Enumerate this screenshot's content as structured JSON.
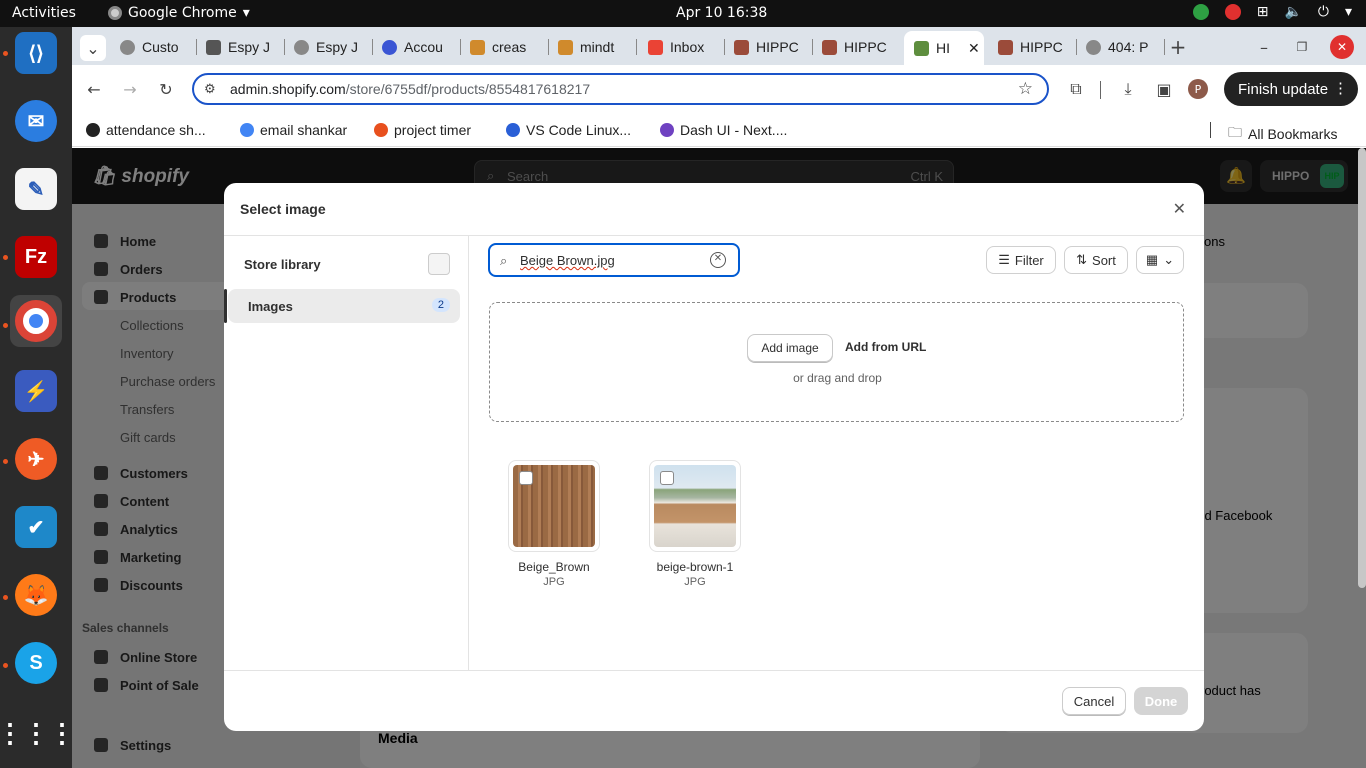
{
  "system": {
    "activities": "Activities",
    "app_name": "Google Chrome",
    "clock": "Apr 10  16:38"
  },
  "dock": {
    "items": [
      "vscode-icon",
      "thunderbird-icon",
      "text-editor-icon",
      "filezilla-icon",
      "chrome-icon",
      "network-icon",
      "postman-icon",
      "todo-icon",
      "firefox-icon",
      "skype-icon",
      "app-grid-icon"
    ]
  },
  "browser": {
    "tabs": [
      "Custo",
      "Espy J",
      "Espy J",
      "Accou",
      "creas",
      "mindt",
      "Inbox",
      "HIPPC",
      "HIPPC",
      "HI",
      "HIPPC",
      "404: P"
    ],
    "active_tab_index": 9,
    "url_host": "admin.shopify.com",
    "url_path": "/store/6755df/products/8554817618217",
    "finish_update": "Finish update",
    "profile_initial": "P",
    "bookmarks": [
      "attendance sh...",
      "email shankar",
      "project timer",
      "VS Code Linux...",
      "Dash UI - Next...."
    ],
    "all_bookmarks": "All Bookmarks"
  },
  "shopify": {
    "logo": "shopify",
    "search_placeholder": "Search",
    "search_shortcut": "Ctrl K",
    "store_name": "HIPPO",
    "store_badge": "HIP",
    "nav": {
      "home": "Home",
      "orders": "Orders",
      "products": "Products",
      "collections": "Collections",
      "inventory": "Inventory",
      "purchase_orders": "Purchase orders",
      "transfers": "Transfers",
      "gift_cards": "Gift cards",
      "customers": "Customers",
      "content": "Content",
      "analytics": "Analytics",
      "marketing": "Marketing",
      "discounts": "Discounts",
      "sales_channels": "Sales channels",
      "online_store": "Online Store",
      "point_of_sale": "Point of Sale",
      "settings": "Settings"
    },
    "background": {
      "media_heading": "Media",
      "partial_ons": "ons",
      "and_facebook": "and Facebook",
      "product_has": "roduct has"
    }
  },
  "modal": {
    "title": "Select image",
    "store_library": "Store library",
    "images_label": "Images",
    "images_count": "2",
    "search_value": "Beige Brown.jpg",
    "filter": "Filter",
    "sort": "Sort",
    "add_image": "Add image",
    "add_from_url": "Add from URL",
    "drag_drop": "or drag and drop",
    "files": [
      {
        "name": "Beige_Brown",
        "type": "JPG"
      },
      {
        "name": "beige-brown-1",
        "type": "JPG"
      }
    ],
    "cancel": "Cancel",
    "done": "Done"
  }
}
